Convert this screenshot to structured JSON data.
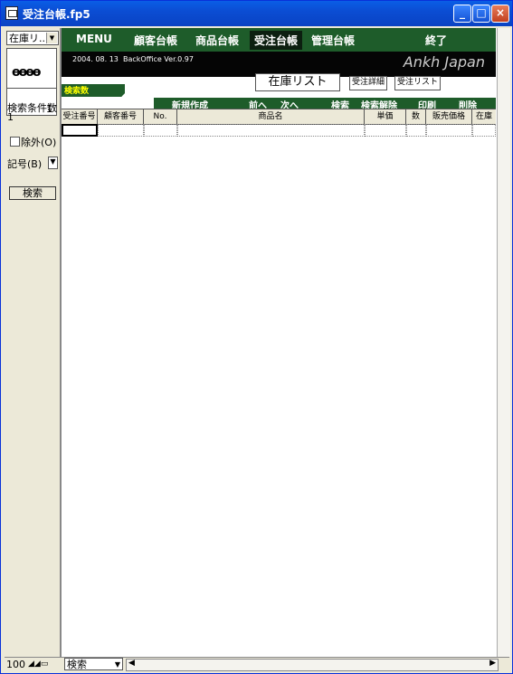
{
  "window": {
    "title": "受注台帳.fp5"
  },
  "left_panel": {
    "layout_select": "在庫リ...",
    "record_number": "1",
    "search_condition_label": "検索条件数",
    "search_condition_count": "1",
    "exclude_label": "除外(O)",
    "symbol_label": "記号(B)",
    "search_button": "検索"
  },
  "menu": {
    "items": [
      "MENU",
      "顧客台帳",
      "商品台帳",
      "受注台帳",
      "管理台帳",
      "終了"
    ],
    "active": "受注台帳"
  },
  "banner": {
    "date": "2004. 08. 13",
    "version": "BackOffice Ver.0.97",
    "brand": "Ankh Japan"
  },
  "search_count_label": "検索数",
  "list_title": "在庫リスト",
  "small_buttons": [
    "受注詳細",
    "受注リスト"
  ],
  "actions": [
    "新規作成",
    "前へ",
    "次へ",
    "検索",
    "検索解除",
    "印刷",
    "削除"
  ],
  "table": {
    "columns": [
      "受注番号",
      "顧客番号",
      "No.",
      "商品名",
      "単価",
      "数",
      "販売価格",
      "在庫"
    ]
  },
  "status": {
    "zoom": "100",
    "mode": "検索"
  }
}
